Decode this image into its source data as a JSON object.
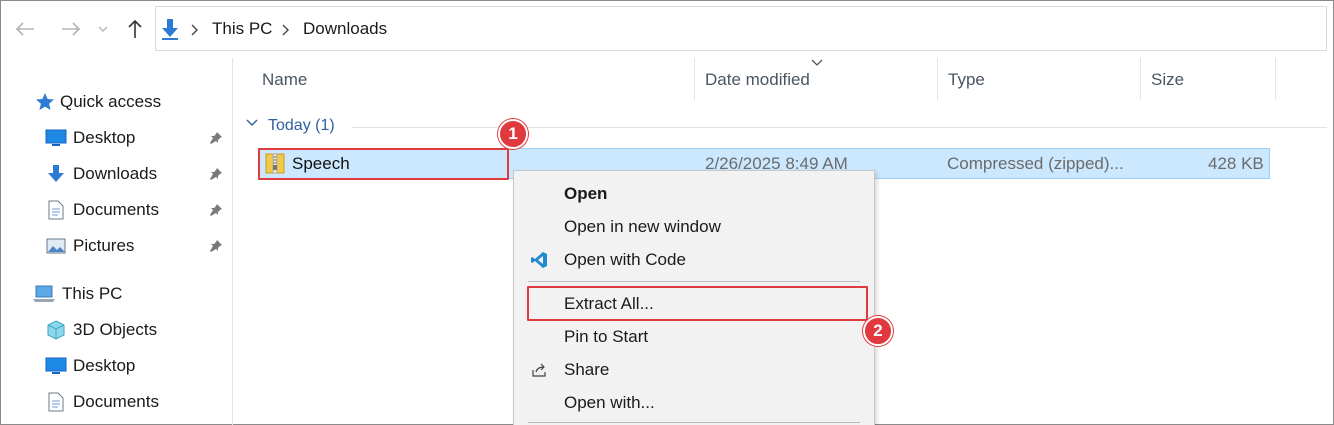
{
  "address_bar": {
    "crumbs": [
      "This PC",
      "Downloads"
    ]
  },
  "sidebar": {
    "quick_access": {
      "label": "Quick access",
      "icon": "star-icon"
    },
    "quick_items": [
      {
        "label": "Desktop",
        "icon": "desktop-icon",
        "pinned": true
      },
      {
        "label": "Downloads",
        "icon": "download-icon",
        "pinned": true
      },
      {
        "label": "Documents",
        "icon": "document-icon",
        "pinned": true
      },
      {
        "label": "Pictures",
        "icon": "pictures-icon",
        "pinned": true
      }
    ],
    "this_pc": {
      "label": "This PC",
      "icon": "computer-icon"
    },
    "pc_items": [
      {
        "label": "3D Objects",
        "icon": "cube-icon"
      },
      {
        "label": "Desktop",
        "icon": "desktop-icon"
      },
      {
        "label": "Documents",
        "icon": "document-icon"
      }
    ]
  },
  "columns": {
    "name": "Name",
    "date_modified": "Date modified",
    "type": "Type",
    "size": "Size"
  },
  "group": {
    "label": "Today (1)"
  },
  "file": {
    "name": "Speech",
    "date_modified": "2/26/2025 8:49 AM",
    "type": "Compressed (zipped)...",
    "size": "428 KB",
    "icon": "zip-folder-icon"
  },
  "context_menu": {
    "open": "Open",
    "open_new_window": "Open in new window",
    "open_with_code": "Open with Code",
    "extract_all": "Extract All...",
    "pin_to_start": "Pin to Start",
    "share": "Share",
    "open_with": "Open with..."
  },
  "callouts": {
    "step1": "1",
    "step2": "2"
  },
  "colors": {
    "selection": "#cce8ff",
    "callout": "#e03a3e",
    "accent": "#2e7bd6"
  }
}
